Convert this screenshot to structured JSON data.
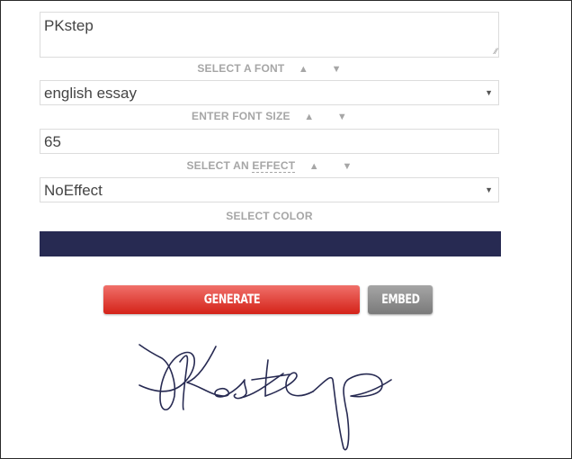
{
  "text_input": {
    "value": "PKstep"
  },
  "font": {
    "label": "SELECT A FONT",
    "up": "▲",
    "down": "▼",
    "selected": "english essay",
    "dropdown_arrow": "▼"
  },
  "font_size": {
    "label": "ENTER FONT SIZE",
    "up": "▲",
    "down": "▼",
    "value": "65"
  },
  "effect": {
    "label_prefix": "SELECT AN",
    "label_link": "EFFECT",
    "up": "▲",
    "down": "▼",
    "selected": "NoEffect",
    "dropdown_arrow": "▼"
  },
  "color": {
    "label": "SELECT COLOR",
    "value": "#272a52"
  },
  "buttons": {
    "generate": "GENERATE",
    "embed": "EMBED"
  },
  "signature_preview": {
    "text": "PKstep",
    "color": "#272a52"
  }
}
